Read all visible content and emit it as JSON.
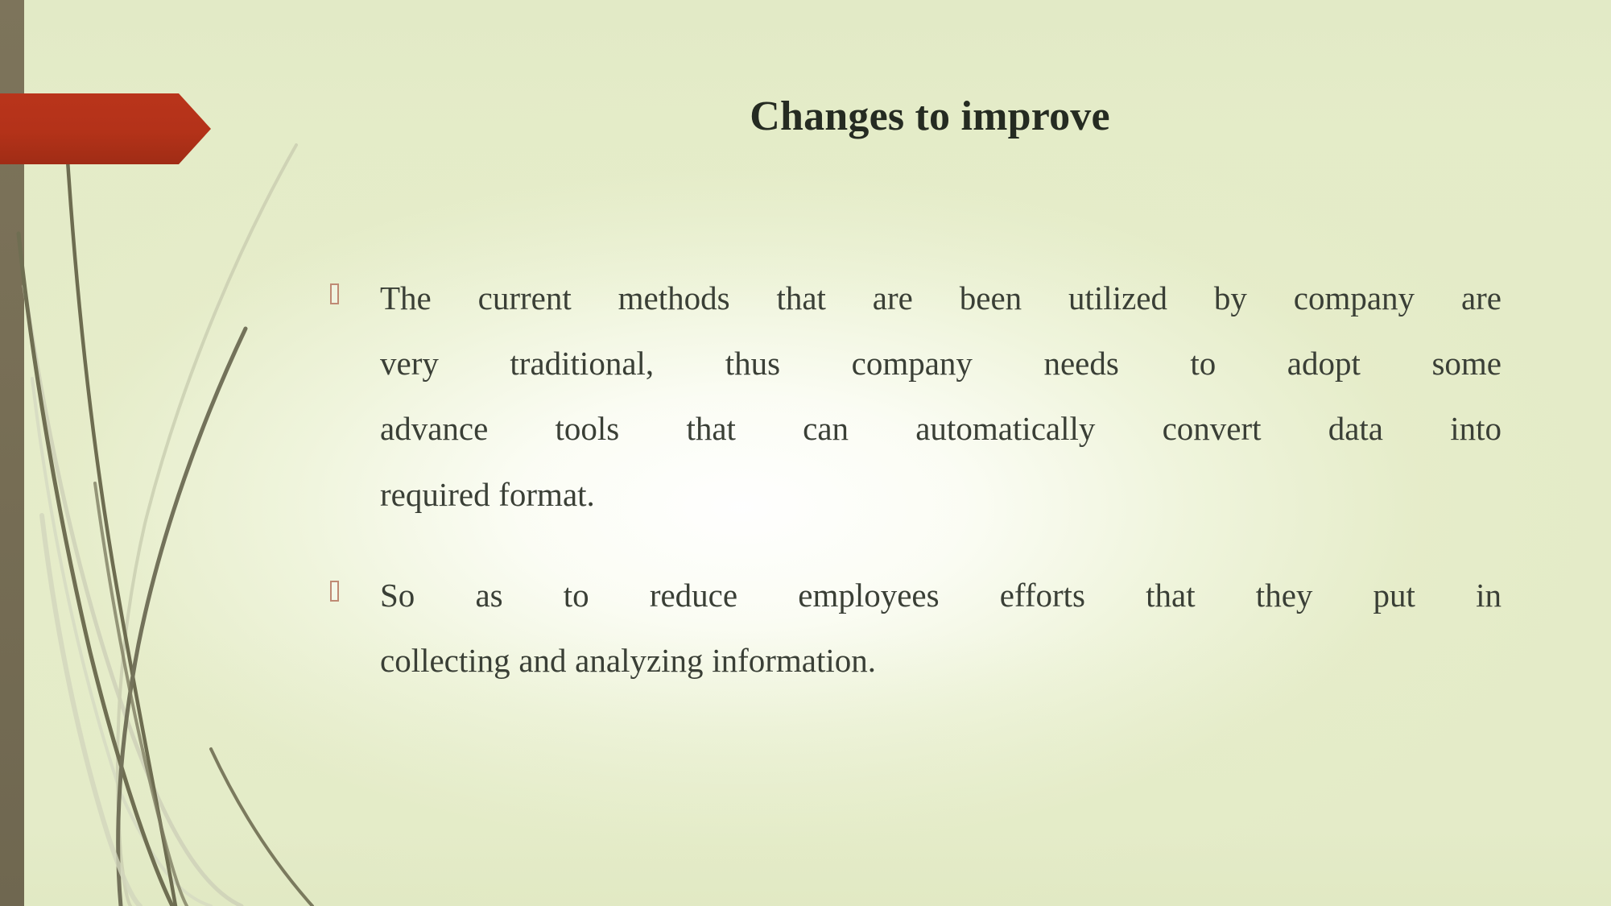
{
  "slide": {
    "title": "Changes to improve",
    "background_color": "#e4ebc8",
    "accent_color": "#b5321a",
    "left_band_color": "#7a7159",
    "title_color": "#252b22",
    "body_text_color": "#3a3f36",
    "bullet_marker_color": "#bf8a74"
  },
  "banner": {
    "name": "red-arrow-banner",
    "fill": "#b5321a"
  },
  "content": {
    "bullets": [
      {
        "marker": "tofu-box-bullet",
        "text": "The current methods that are been utilized by company are very traditional, thus company needs to adopt some advance tools that can automatically convert data into required format.",
        "lines": [
          "The current methods that are been utilized by company are",
          "very traditional, thus company needs to adopt some",
          "advance tools that can automatically convert data into",
          "required format."
        ]
      },
      {
        "marker": "tofu-box-bullet",
        "text": "So as to reduce employees efforts that they put in collecting and analyzing information.",
        "lines": [
          "So as to reduce employees efforts that they put in",
          "collecting and analyzing information."
        ]
      }
    ]
  },
  "decoration": {
    "grass_blade_dark": "#6b6a4f",
    "grass_blade_mid": "#8d8c6d",
    "grass_blade_light": "#c9cdb0"
  }
}
